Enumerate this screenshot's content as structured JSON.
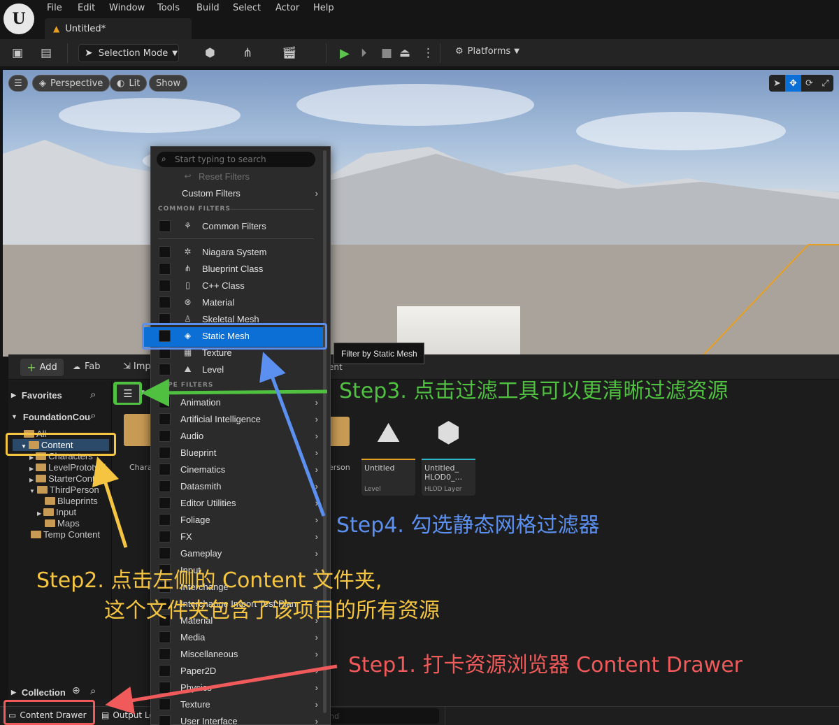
{
  "app": {
    "logo_text": "U",
    "doc_tab": "Untitled*"
  },
  "menu": [
    "File",
    "Edit",
    "Window",
    "Tools",
    "Build",
    "Select",
    "Actor",
    "Help"
  ],
  "toolbar": {
    "mode": "Selection Mode",
    "platforms": "Platforms"
  },
  "viewport": {
    "perspective": "Perspective",
    "lit": "Lit",
    "show": "Show"
  },
  "content_browser": {
    "add": "Add",
    "fab": "Fab",
    "import": "Imp",
    "favorites": "Favorites",
    "project": "FoundationCou",
    "collection": "Collection",
    "tree": [
      "All",
      "Content",
      "Characters",
      "LevelPrototypi",
      "StarterCont",
      "ThirdPerson",
      "Blueprints",
      "Input",
      "Maps",
      "Temp Content"
    ],
    "path_fragment": "ent",
    "tiles": [
      {
        "name": "Untitled",
        "type": "Level"
      },
      {
        "name": "Untitled_\nHLOD0_...",
        "type": "HLOD Layer"
      }
    ],
    "hidden_tiles": [
      "Chara",
      "erson"
    ],
    "bottom": {
      "drawer": "Content Drawer",
      "output": "Output Lo",
      "search_fragment": "nd"
    }
  },
  "filter_menu": {
    "search_placeholder": "Start typing to search",
    "reset": "Reset Filters",
    "custom": "Custom Filters",
    "section_common": "COMMON FILTERS",
    "section_type": "PE FILTERS",
    "common": [
      {
        "label": "Common Filters",
        "icon": "filter-icon"
      },
      {
        "label": "Niagara System",
        "icon": "niagara-icon"
      },
      {
        "label": "Blueprint Class",
        "icon": "blueprint-icon"
      },
      {
        "label": "C++ Class",
        "icon": "cpp-icon"
      },
      {
        "label": "Material",
        "icon": "material-icon"
      },
      {
        "label": "Skeletal Mesh",
        "icon": "skeleton-icon"
      },
      {
        "label": "Static Mesh",
        "icon": "static-mesh-icon"
      },
      {
        "label": "Texture",
        "icon": "texture-icon"
      },
      {
        "label": "Level",
        "icon": "level-icon"
      }
    ],
    "categories": [
      "Animation",
      "Artificial Intelligence",
      "Audio",
      "Blueprint",
      "Cinematics",
      "Datasmith",
      "Editor Utilities",
      "Foliage",
      "FX",
      "Gameplay",
      "Input",
      "Interchange",
      "Interchange Import Test Plan",
      "Material",
      "Media",
      "Miscellaneous",
      "Paper2D",
      "Physics",
      "Texture",
      "User Interface"
    ],
    "tooltip": "Filter by Static Mesh"
  },
  "annotations": {
    "step1": "Step1. 打卡资源浏览器 Content Drawer",
    "step2_line1": "Step2. 点击左侧的 Content 文件夹,",
    "step2_line2": "这个文件夹包含了该项目的所有资源",
    "step3": "Step3. 点击过滤工具可以更清晰过滤资源",
    "step4": "Step4. 勾选静态网格过滤器"
  },
  "colors": {
    "accent_blue": "#0b6fd6",
    "step1": "#f05a5a",
    "step2": "#f5c542",
    "step3": "#4fc040",
    "step4": "#5b8ff0"
  }
}
